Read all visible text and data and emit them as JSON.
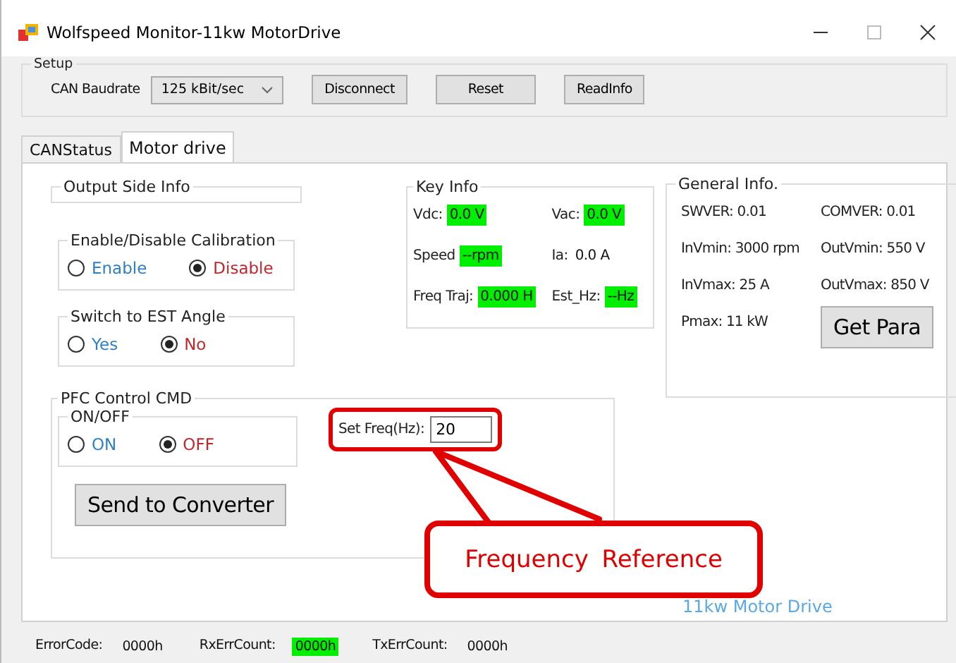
{
  "window": {
    "title": "Wolfspeed Monitor-11kw MotorDrive"
  },
  "setup": {
    "title": "Setup",
    "baudrate_label": "CAN Baudrate",
    "baudrate": "125 kBit/sec",
    "buttons": [
      "Disconnect",
      "Reset",
      "ReadInfo"
    ]
  },
  "tabs": [
    {
      "label": "CANStatus",
      "selected": false
    },
    {
      "label": "Motor drive",
      "selected": true
    }
  ],
  "output_side_info": {
    "title": "Output Side Info"
  },
  "calibration": {
    "title": "Enable/Disable Calibration",
    "options": [
      {
        "label": "Enable",
        "selected": false
      },
      {
        "label": "Disable",
        "selected": true
      }
    ]
  },
  "est_angle": {
    "title": "Switch to EST Angle",
    "options": [
      {
        "label": "Yes",
        "selected": false
      },
      {
        "label": "No",
        "selected": true
      }
    ]
  },
  "key_info": {
    "title": "Key Info",
    "items": [
      {
        "label": "Vdc:",
        "value": "0.0 V",
        "highlight": true
      },
      {
        "label": "Vac:",
        "value": "0.0 V",
        "highlight": true
      },
      {
        "label": "Speed",
        "value": "--rpm",
        "highlight": true
      },
      {
        "label": "Ia:",
        "value": "0.0 A",
        "highlight": false
      },
      {
        "label": "Freq Traj:",
        "value": "0.000 H",
        "highlight": true
      },
      {
        "label": "Est_Hz:",
        "value": "--Hz",
        "highlight": true
      }
    ]
  },
  "general_info": {
    "title": "General Info.",
    "items": [
      "SWVER: 0.01",
      "COMVER: 0.01",
      "InVmin: 3000 rpm",
      "OutVmin: 550 V",
      "InVmax: 25 A",
      "OutVmax: 850 V",
      "Pmax: 11 kW"
    ],
    "button": "Get Para"
  },
  "pfc": {
    "title": "PFC Control CMD",
    "onoff": {
      "title": "ON/OFF",
      "options": [
        {
          "label": "ON",
          "selected": false
        },
        {
          "label": "OFF",
          "selected": true
        }
      ]
    },
    "freq_label": "Set Freq(Hz):",
    "freq_value": "20",
    "button": "Send to Converter"
  },
  "callout": "Frequency Reference",
  "brand": "11kw Motor Drive",
  "status_bar": [
    {
      "label": "ErrorCode:",
      "value": "0000h",
      "highlight": false
    },
    {
      "label": "RxErrCount:",
      "value": "0000h",
      "highlight": true
    },
    {
      "label": "TxErrCount:",
      "value": "0000h",
      "highlight": false
    }
  ]
}
